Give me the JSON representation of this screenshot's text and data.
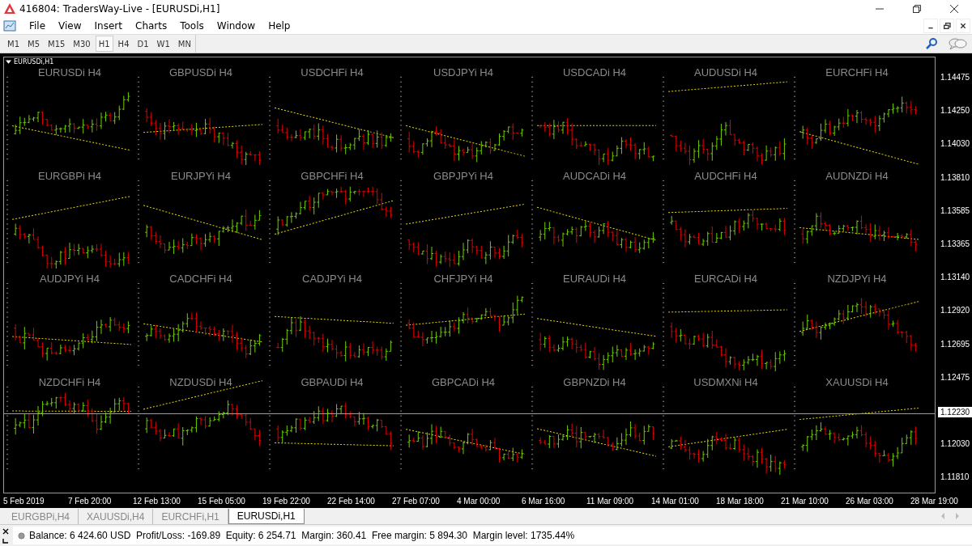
{
  "window": {
    "title": "416804: TradersWay-Live - [EURUSDi,H1]"
  },
  "menu": [
    "File",
    "View",
    "Insert",
    "Charts",
    "Tools",
    "Window",
    "Help"
  ],
  "timeframes": [
    {
      "label": "M1",
      "selected": false
    },
    {
      "label": "M5",
      "selected": false
    },
    {
      "label": "M15",
      "selected": false
    },
    {
      "label": "M30",
      "selected": false
    },
    {
      "label": "H1",
      "selected": true
    },
    {
      "label": "H4",
      "selected": false
    },
    {
      "label": "D1",
      "selected": false
    },
    {
      "label": "W1",
      "selected": false
    },
    {
      "label": "MN",
      "selected": false
    }
  ],
  "chart": {
    "symbol": "EURUSDi,H1",
    "tiles": [
      "EURUSDi H4",
      "GBPUSDi H4",
      "USDCHFi H4",
      "USDJPYi H4",
      "USDCADi H4",
      "AUDUSDi H4",
      "EURCHFi H4",
      "EURGBPi H4",
      "EURJPYi H4",
      "GBPCHFi H4",
      "GBPJPYi H4",
      "AUDCADi H4",
      "AUDCHFi H4",
      "AUDNZDi H4",
      "AUDJPYi H4",
      "CADCHFi H4",
      "CADJPYi H4",
      "CHFJPYi H4",
      "EURAUDi H4",
      "EURCADi H4",
      "NZDJPYi H4",
      "NZDCHFi H4",
      "NZDUSDi H4",
      "GBPAUDi H4",
      "GBPCADi H4",
      "GBPNZDi H4",
      "USDMXNi H4",
      "XAUUSDi H4"
    ],
    "price_axis": [
      "1.14475",
      "1.14250",
      "1.14030",
      "1.13810",
      "1.13585",
      "1.13365",
      "1.13140",
      "1.12920",
      "1.12695",
      "1.12475",
      "1.12030",
      "1.11810"
    ],
    "current_price": "1.12230",
    "time_axis": [
      "5 Feb 2019",
      "7 Feb 20:00",
      "12 Feb 13:00",
      "15 Feb 05:00",
      "19 Feb 22:00",
      "22 Feb 14:00",
      "27 Feb 07:00",
      "4 Mar 00:00",
      "6 Mar 16:00",
      "11 Mar 09:00",
      "14 Mar 01:00",
      "18 Mar 18:00",
      "21 Mar 10:00",
      "26 Mar 03:00",
      "28 Mar 19:00"
    ]
  },
  "tabs": [
    {
      "label": "EURGBPi,H4",
      "selected": false
    },
    {
      "label": "XAUUSDi,H4",
      "selected": false
    },
    {
      "label": "EURCHFi,H1",
      "selected": false
    },
    {
      "label": "EURUSDi,H1",
      "selected": true
    }
  ],
  "status_bar": {
    "text": "Balance: 6 424.60 USD  Profit/Loss: -169.89  Equity: 6 254.71  Margin: 360.41  Free margin: 5 894.30  Margin level: 1735.44%"
  }
}
